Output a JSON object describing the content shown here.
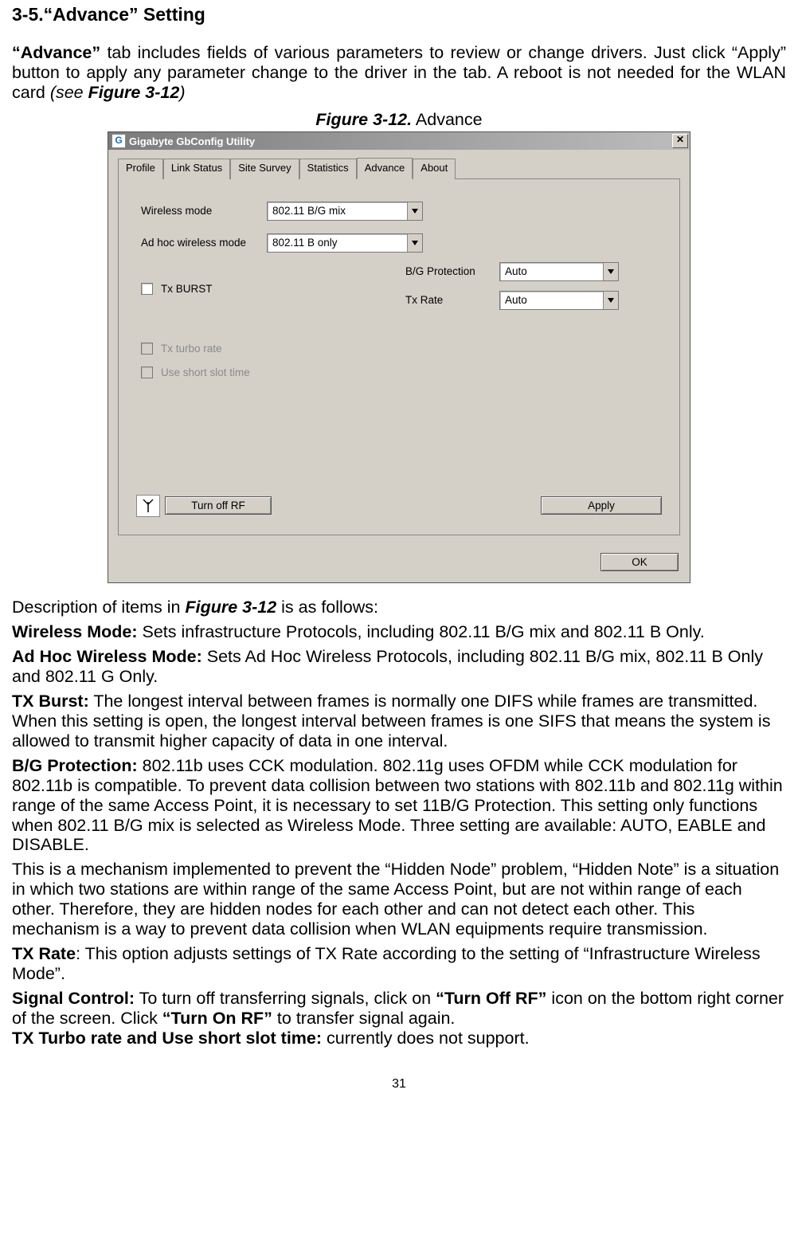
{
  "heading": "3-5.“Advance” Setting",
  "intro": {
    "lead_bold": "“Advance”",
    "rest": " tab includes fields of various parameters to review or change drivers. Just click “Apply” button to apply any parameter change to the driver in the tab. A reboot is not needed for the WLAN card ",
    "see_italic": "(see ",
    "fig_ref": "Figure 3-12",
    "close_paren": ")"
  },
  "fig_caption": {
    "bold": "Figure 3-12.",
    "rest": "    Advance"
  },
  "window": {
    "app_icon_letter": "G",
    "title": "Gigabyte GbConfig Utility",
    "close_symbol": "✕",
    "tabs": [
      "Profile",
      "Link Status",
      "Site Survey",
      "Statistics",
      "Advance",
      "About"
    ],
    "active_tab_index": 4,
    "labels": {
      "wireless_mode": "Wireless mode",
      "adhoc_mode": "Ad hoc wireless mode",
      "tx_burst": "Tx BURST",
      "bg_protection": "B/G Protection",
      "tx_rate": "Tx Rate",
      "tx_turbo": "Tx turbo rate",
      "short_slot": "Use short slot time"
    },
    "values": {
      "wireless_mode": "802.11 B/G mix",
      "adhoc_mode": "802.11 B only",
      "bg_protection": "Auto",
      "tx_rate": "Auto"
    },
    "buttons": {
      "turn_off_rf": "Turn off RF",
      "apply": "Apply",
      "ok": "OK"
    }
  },
  "desc_intro_pre": "Description of items in ",
  "desc_intro_ref": "Figure 3-12",
  "desc_intro_post": " is as follows:",
  "items": {
    "wireless_mode_t": "Wireless Mode:",
    "wireless_mode_b": " Sets infrastructure Protocols, including 802.11 B/G mix and 802.11 B Only.",
    "adhoc_t": "Ad Hoc Wireless Mode:",
    "adhoc_b": " Sets Ad Hoc Wireless Protocols, including 802.11 B/G mix, 802.11 B Only and 802.11 G Only.",
    "txburst_t": "TX Burst:",
    "txburst_b": " The longest interval between frames is normally one DIFS while frames are transmitted. When this setting is open, the longest interval between frames is one SIFS that means the system is allowed to transmit higher capacity of data in one interval.",
    "bgprot_t": "B/G Protection:",
    "bgprot_b": " 802.11b uses CCK modulation. 802.11g uses OFDM while CCK modulation for 802.11b is compatible. To prevent data collision between two stations with 802.11b and 802.11g within range of the same Access Point, it is necessary to set 11B/G Protection. This setting only functions when 802.11 B/G mix is selected as Wireless Mode. Three setting are available: AUTO, EABLE and DISABLE.",
    "hidden_body": "This is a mechanism implemented to prevent the “Hidden Node” problem, “Hidden Note” is a situation in which two stations are within range of the same Access Point, but are not within range of each other. Therefore, they are hidden nodes for each other and can not detect each other. This mechanism is a way to prevent data collision when WLAN equipments require transmission.",
    "txrate_t": "TX Rate",
    "txrate_b": ": This option adjusts settings of TX Rate according to the setting of “Infrastructure Wireless Mode”.",
    "signal_t": "Signal Control:",
    "signal_b1": " To turn off transferring signals, click on ",
    "signal_q1": "“Turn Off RF”",
    "signal_b2": " icon on the bottom right corner of the screen. Click ",
    "signal_q2": "“Turn On RF”",
    "signal_b3": " to transfer signal again.",
    "txturbo_t": "TX Turbo rate and Use short slot time:",
    "txturbo_b": " currently does not support."
  },
  "page_number": "31"
}
